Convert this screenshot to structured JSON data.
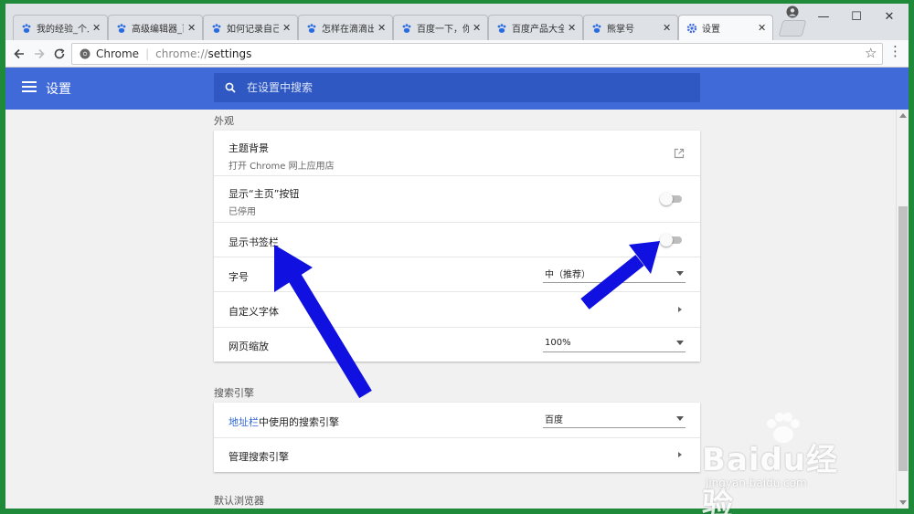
{
  "tabs": [
    {
      "title": "我的经验_个人",
      "active": false
    },
    {
      "title": "高级编辑器_百",
      "active": false
    },
    {
      "title": "如何记录自己",
      "active": false
    },
    {
      "title": "怎样在滴滴出",
      "active": false
    },
    {
      "title": "百度一下，你",
      "active": false
    },
    {
      "title": "百度产品大全",
      "active": false
    },
    {
      "title": "熊掌号",
      "active": false
    },
    {
      "title": "设置",
      "active": true
    }
  ],
  "window_controls": {
    "minimize": "—",
    "maximize": "☐",
    "close": "✕"
  },
  "address_bar": {
    "site_label": "Chrome",
    "url_scheme": "chrome://",
    "url_host": "settings"
  },
  "header": {
    "title": "设置",
    "search_placeholder": "在设置中搜索"
  },
  "appearance": {
    "section_title": "外观",
    "theme": {
      "label": "主题背景",
      "sub": "打开 Chrome 网上应用店"
    },
    "home_button": {
      "label": "显示“主页”按钮",
      "sub": "已停用",
      "enabled": false
    },
    "bookmarks_bar": {
      "label": "显示书签栏",
      "enabled": false
    },
    "font_size": {
      "label": "字号",
      "value": "中（推荐）"
    },
    "custom_fonts": {
      "label": "自定义字体"
    },
    "page_zoom": {
      "label": "网页缩放",
      "value": "100%"
    }
  },
  "search_engine": {
    "section_title": "搜索引擎",
    "address_bar_engine": {
      "label_link": "地址栏",
      "label_rest": "中使用的搜索引擎",
      "value": "百度"
    },
    "manage": {
      "label": "管理搜索引擎"
    }
  },
  "default_browser": {
    "section_title": "默认浏览器"
  },
  "watermark": {
    "logo": "Baidu经验",
    "url": "jingyan.baidu.com"
  },
  "colors": {
    "header_blue": "#3f6ad8",
    "search_blue": "#2f58c2",
    "arrow_blue": "#1010e0",
    "link_blue": "#3367d6",
    "frame_green": "#1e8a3a"
  }
}
